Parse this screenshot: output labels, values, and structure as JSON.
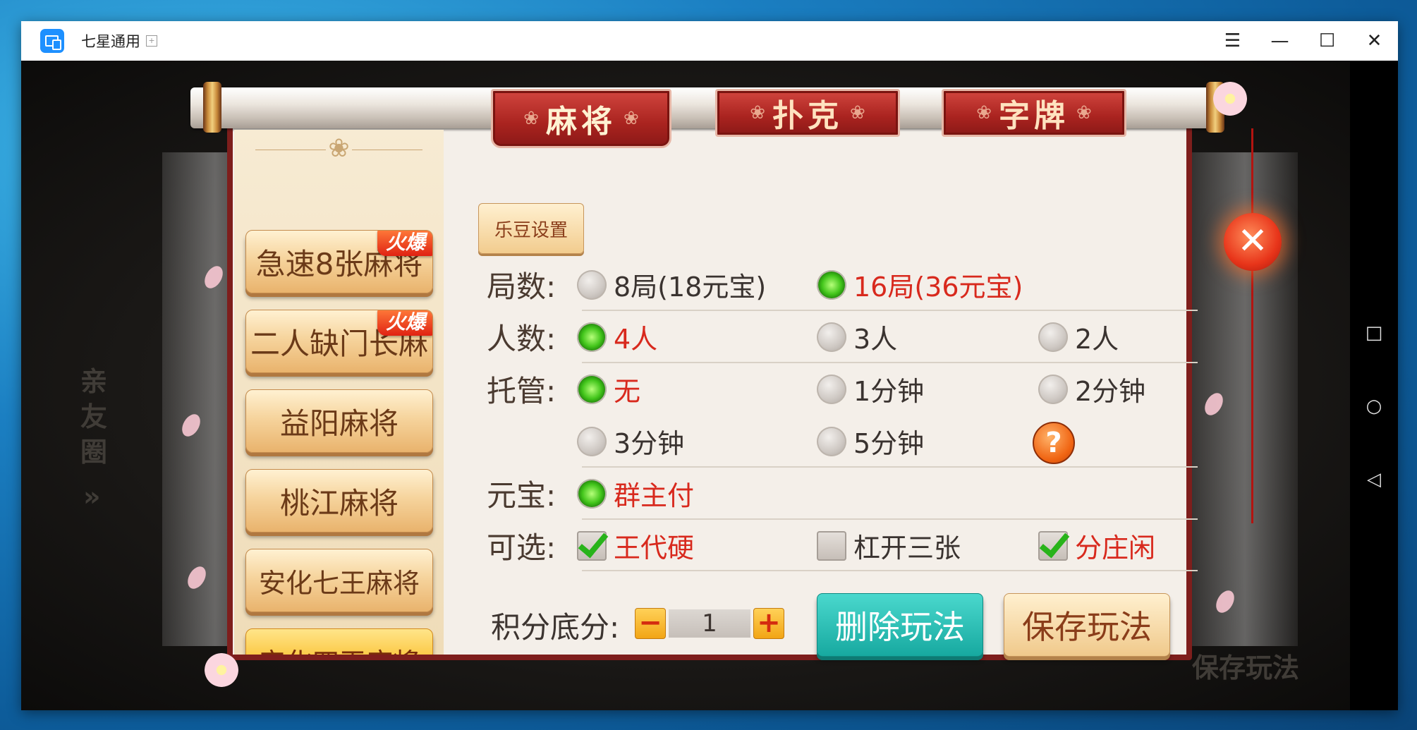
{
  "window": {
    "title": "七星通用",
    "controls": [
      "☰",
      "—",
      "☐",
      "✕"
    ]
  },
  "side_nav": [
    "□",
    "○",
    "◁"
  ],
  "tabs": [
    {
      "label": "麻将",
      "active": true
    },
    {
      "label": "扑克",
      "active": false
    },
    {
      "label": "字牌",
      "active": false
    }
  ],
  "games": [
    {
      "label": "急速8张麻将",
      "badge": "火爆",
      "active": false
    },
    {
      "label": "二人缺门长麻",
      "badge": "火爆",
      "active": false
    },
    {
      "label": "益阳麻将",
      "badge": "",
      "active": false
    },
    {
      "label": "桃江麻将",
      "badge": "",
      "active": false
    },
    {
      "label": "安化七王麻将",
      "badge": "",
      "active": false
    },
    {
      "label": "安化四王麻将",
      "badge": "",
      "active": true
    }
  ],
  "ledou_label": "乐豆设置",
  "rows": {
    "rounds": {
      "label": "局数:",
      "options": [
        {
          "text": "8局(18元宝)",
          "on": false
        },
        {
          "text": "16局(36元宝)",
          "on": true
        }
      ]
    },
    "players": {
      "label": "人数:",
      "options": [
        {
          "text": "4人",
          "on": true
        },
        {
          "text": "3人",
          "on": false
        },
        {
          "text": "2人",
          "on": false
        }
      ]
    },
    "autoplay": {
      "label": "托管:",
      "options": [
        {
          "text": "无",
          "on": true
        },
        {
          "text": "1分钟",
          "on": false
        },
        {
          "text": "2分钟",
          "on": false
        },
        {
          "text": "3分钟",
          "on": false
        },
        {
          "text": "5分钟",
          "on": false
        }
      ]
    },
    "ingot": {
      "label": "元宝:",
      "options": [
        {
          "text": "群主付",
          "on": true
        }
      ]
    },
    "optional": {
      "label": "可选:",
      "options": [
        {
          "text": "王代硬",
          "on": true
        },
        {
          "text": "杠开三张",
          "on": false
        },
        {
          "text": "分庄闲",
          "on": true
        }
      ]
    }
  },
  "help_icon": "?",
  "score": {
    "label": "积分底分:",
    "value": "1",
    "minus": "−",
    "plus": "+"
  },
  "buttons": {
    "delete": "删除玩法",
    "save": "保存玩法"
  },
  "close_icon": "✕",
  "background_text": {
    "side": "亲友圈",
    "chevrons": "»",
    "bottom_right": "保存玩法"
  },
  "colors": {
    "selected_text": "#d8291d",
    "tab_red": "#a9231f",
    "teal_button": "#17a9a0"
  }
}
